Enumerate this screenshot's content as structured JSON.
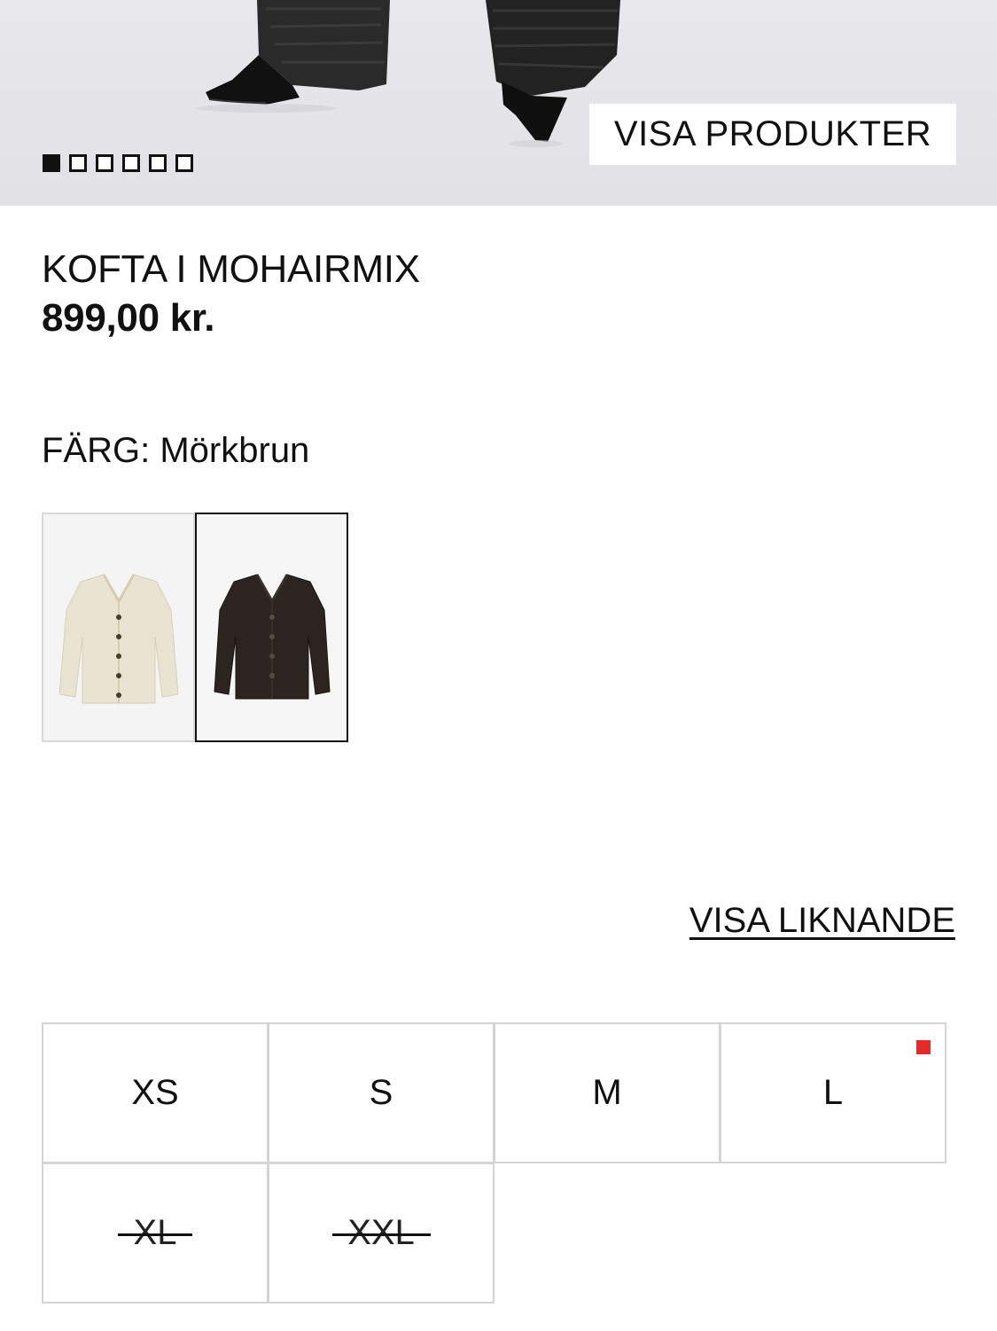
{
  "hero": {
    "cta_label": "VISA PRODUKTER",
    "carousel": {
      "total": 6,
      "active_index": 0
    }
  },
  "product": {
    "title": "KOFTA I MOHAIRMIX",
    "price": "899,00 kr."
  },
  "color": {
    "label": "FÄRG:",
    "value": "Mörkbrun",
    "swatches": [
      {
        "name": "beige-cardigan",
        "color": "#e8e1cf",
        "selected": false
      },
      {
        "name": "dark-brown-cardigan",
        "color": "#2b2420",
        "selected": true
      }
    ]
  },
  "similar_link": "VISA LIKNANDE",
  "sizes": [
    {
      "label": "XS",
      "available": true,
      "low_stock": false
    },
    {
      "label": "S",
      "available": true,
      "low_stock": false
    },
    {
      "label": "M",
      "available": true,
      "low_stock": false
    },
    {
      "label": "L",
      "available": true,
      "low_stock": true
    },
    {
      "label": "XL",
      "available": false,
      "low_stock": false
    },
    {
      "label": "XXL",
      "available": false,
      "low_stock": false
    }
  ],
  "colors": {
    "low_stock_indicator": "#e32b2b",
    "text": "#111111",
    "border": "#d4d4d4"
  }
}
